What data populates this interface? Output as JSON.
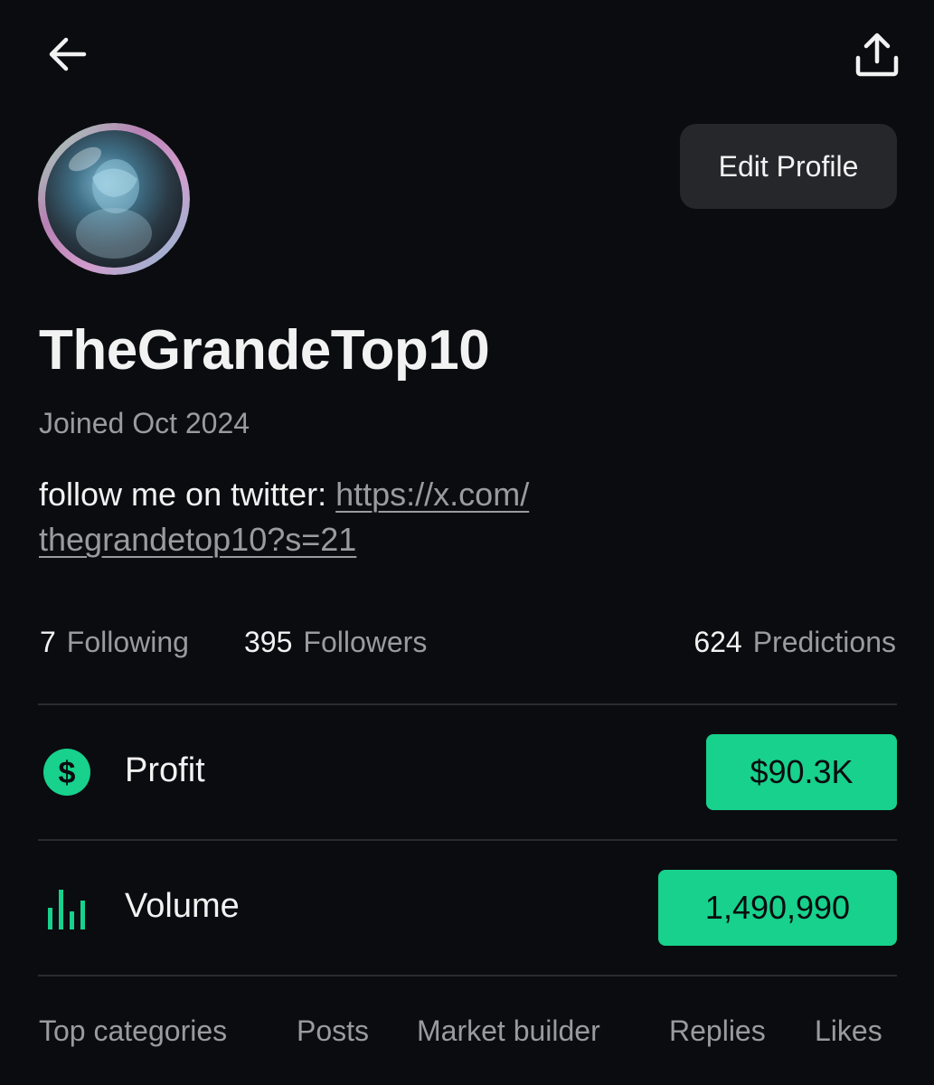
{
  "nav": {
    "back_icon": "arrow-left-icon",
    "share_icon": "share-upload-icon"
  },
  "profile": {
    "avatar_icon": "avatar",
    "edit_label": "Edit Profile",
    "username": "TheGrandeTop10",
    "joined": "Joined Oct 2024",
    "bio_prefix": "follow me on twitter: ",
    "bio_link_line1": "https://x.com/",
    "bio_link_line2": "thegrandetop10?s=21"
  },
  "stats": {
    "following_count": "7",
    "following_label": "Following",
    "followers_count": "395",
    "followers_label": "Followers",
    "predictions_count": "624",
    "predictions_label": "Predictions"
  },
  "metrics": {
    "profit_icon": "dollar-circle-icon",
    "profit_label": "Profit",
    "profit_value": "$90.3K",
    "volume_icon": "bar-chart-icon",
    "volume_label": "Volume",
    "volume_value": "1,490,990"
  },
  "tabs": [
    {
      "label": "Top categories"
    },
    {
      "label": "Posts"
    },
    {
      "label": "Market builder"
    },
    {
      "label": "Replies"
    },
    {
      "label": "Likes"
    }
  ],
  "colors": {
    "background": "#0b0c0f",
    "accent_green": "#17d18c",
    "muted_text": "#9a9ba0",
    "button_bg": "#26272b"
  }
}
